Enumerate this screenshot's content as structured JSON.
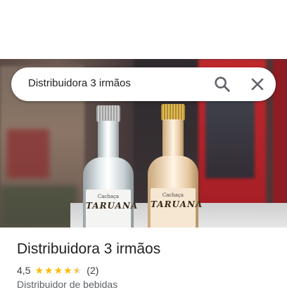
{
  "search": {
    "query": "Distribuidora 3 irmãos"
  },
  "place": {
    "name": "Distribuidora 3 irmãos",
    "rating": "4,5",
    "rating_value": 4.5,
    "stars": [
      "full",
      "full",
      "full",
      "full",
      "half"
    ],
    "review_count": "(2)",
    "category": "Distribuidor de bebidas"
  },
  "photo": {
    "bottle_label_line1": "Cachaça",
    "bottle_label_line2": "TARUANA"
  },
  "icons": {
    "search": "search-icon",
    "close": "close-icon",
    "star": "star-icon"
  },
  "colors": {
    "star": "#fbbc04",
    "icon": "#5f6368",
    "title_text": "#202124",
    "secondary_text": "#5f6368"
  }
}
